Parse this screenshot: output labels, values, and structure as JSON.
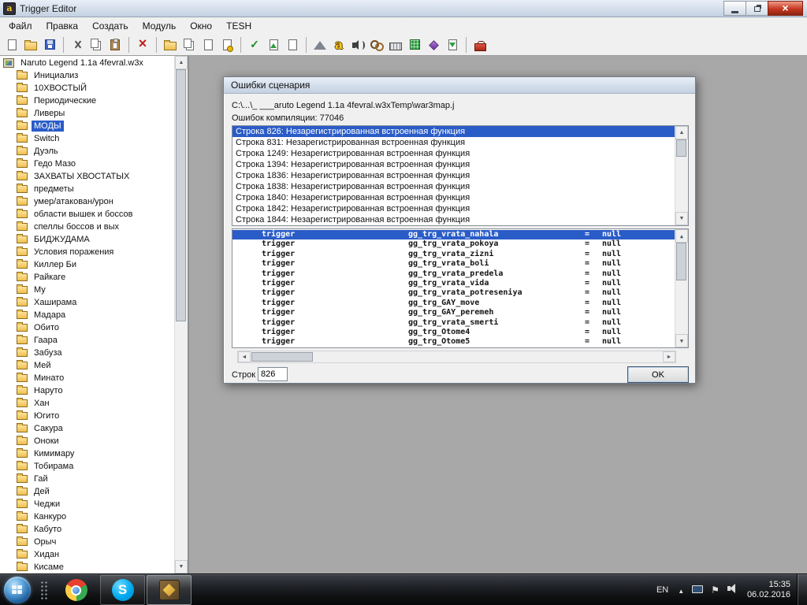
{
  "colors": {
    "selection": "#2a5cc8",
    "close": "#c4371f",
    "titlebar_top": "#e9eff8",
    "titlebar_bottom": "#c3d1e1"
  },
  "window": {
    "title": "Trigger Editor"
  },
  "menubar": {
    "items": [
      {
        "id": "file",
        "label": "Файл"
      },
      {
        "id": "edit",
        "label": "Правка"
      },
      {
        "id": "create",
        "label": "Создать"
      },
      {
        "id": "module",
        "label": "Модуль"
      },
      {
        "id": "window",
        "label": "Окно"
      },
      {
        "id": "tesh",
        "label": "TESH"
      }
    ]
  },
  "toolbar": {
    "items": [
      {
        "name": "new-map-icon",
        "kind": "page"
      },
      {
        "name": "open-map-icon",
        "kind": "folderopen"
      },
      {
        "name": "save-map-icon",
        "kind": "floppy"
      },
      {
        "sep": true
      },
      {
        "name": "cut-icon",
        "kind": "scissors"
      },
      {
        "name": "copy-icon",
        "kind": "copy"
      },
      {
        "name": "paste-icon",
        "kind": "paste"
      },
      {
        "sep": true
      },
      {
        "name": "delete-icon",
        "kind": "xred"
      },
      {
        "sep": true
      },
      {
        "name": "new-category-icon",
        "kind": "folderopen"
      },
      {
        "name": "new-trigger-icon",
        "kind": "copy"
      },
      {
        "name": "new-comment-icon",
        "kind": "page"
      },
      {
        "name": "new-script-icon",
        "kind": "pagestar"
      },
      {
        "sep": true
      },
      {
        "name": "enable-trigger-icon",
        "kind": "check"
      },
      {
        "name": "convert-script-icon",
        "kind": "pageup"
      },
      {
        "name": "run-on-init-icon",
        "kind": "page"
      },
      {
        "sep": true
      },
      {
        "name": "terrain-editor-icon",
        "kind": "terrain"
      },
      {
        "name": "trigger-editor-icon",
        "kind": "lettera"
      },
      {
        "name": "sound-editor-icon",
        "kind": "sound"
      },
      {
        "name": "object-editor-icon",
        "kind": "rings"
      },
      {
        "name": "campaign-editor-icon",
        "kind": "keyboard"
      },
      {
        "name": "ai-editor-icon",
        "kind": "gridgreen"
      },
      {
        "name": "object-manager-icon",
        "kind": "diamond"
      },
      {
        "name": "import-manager-icon",
        "kind": "pageimp"
      },
      {
        "sep": true
      },
      {
        "name": "test-map-icon",
        "kind": "toolbox"
      }
    ]
  },
  "tree": {
    "root": "Naruto Legend 1.1a 4fevral.w3x",
    "items": [
      {
        "label": "Инициализ"
      },
      {
        "label": "10ХВОСТЫЙ"
      },
      {
        "label": "Периодические"
      },
      {
        "label": "Ливеры"
      },
      {
        "label": "МОДЫ",
        "selected": true
      },
      {
        "label": "Switch"
      },
      {
        "label": "Дуэль"
      },
      {
        "label": "Гедо Мазо"
      },
      {
        "label": "ЗАХВАТЫ ХВОСТАТЫХ"
      },
      {
        "label": "предметы"
      },
      {
        "label": "умер/атакован/урон"
      },
      {
        "label": "области вышек и боссов"
      },
      {
        "label": "спеллы боссов и вых"
      },
      {
        "label": "БИДЖУДАМА"
      },
      {
        "label": "Условия поражения"
      },
      {
        "label": "Киллер Би"
      },
      {
        "label": "Райкаге"
      },
      {
        "label": "Му"
      },
      {
        "label": "Хаширама"
      },
      {
        "label": "Мадара"
      },
      {
        "label": "Обито"
      },
      {
        "label": "Гаара"
      },
      {
        "label": "Забуза"
      },
      {
        "label": "Мей"
      },
      {
        "label": "Минато"
      },
      {
        "label": "Наруто"
      },
      {
        "label": "Хан"
      },
      {
        "label": "Югито"
      },
      {
        "label": "Сакура"
      },
      {
        "label": "Оноки"
      },
      {
        "label": "Кимимару"
      },
      {
        "label": "Тобирама"
      },
      {
        "label": "Гай"
      },
      {
        "label": "Дей"
      },
      {
        "label": "Чеджи"
      },
      {
        "label": "Канкуро"
      },
      {
        "label": "Кабуто"
      },
      {
        "label": "Орыч"
      },
      {
        "label": "Хидан"
      },
      {
        "label": "Кисаме"
      }
    ]
  },
  "dialog": {
    "title": "Ошибки сценария",
    "file_path": "C:\\...\\_ ___aruto Legend 1.1a 4fevral.w3xTemp\\war3map.j",
    "error_count_label": "Ошибок компиляции: 77046",
    "selected_error_index": 0,
    "errors": [
      "Строка 826: Незарегистрированная встроенная функция",
      "Строка 831: Незарегистрированная встроенная функция",
      "Строка 1249: Незарегистрированная встроенная функция",
      "Строка 1394: Незарегистрированная встроенная функция",
      "Строка 1836: Незарегистрированная встроенная функция",
      "Строка 1838: Незарегистрированная встроенная функция",
      "Строка 1840: Незарегистрированная встроенная функция",
      "Строка 1842: Незарегистрированная встроенная функция",
      "Строка 1844: Незарегистрированная встроенная функция"
    ],
    "code": {
      "selected_index": 0,
      "lines": [
        {
          "kw": "trigger",
          "name": "gg_trg_vrata_nahala",
          "eq": "=",
          "val": "null"
        },
        {
          "kw": "trigger",
          "name": "gg_trg_vrata_pokoya",
          "eq": "=",
          "val": "null"
        },
        {
          "kw": "trigger",
          "name": "gg_trg_vrata_zizni",
          "eq": "=",
          "val": "null"
        },
        {
          "kw": "trigger",
          "name": "gg_trg_vrata_boli",
          "eq": "=",
          "val": "null"
        },
        {
          "kw": "trigger",
          "name": "gg_trg_vrata_predela",
          "eq": "=",
          "val": "null"
        },
        {
          "kw": "trigger",
          "name": "gg_trg_vrata_vida",
          "eq": "=",
          "val": "null"
        },
        {
          "kw": "trigger",
          "name": "gg_trg_vrata_potreseniya",
          "eq": "=",
          "val": "null"
        },
        {
          "kw": "trigger",
          "name": "gg_trg_GAY_move",
          "eq": "=",
          "val": "null"
        },
        {
          "kw": "trigger",
          "name": "gg_trg_GAY_peremeh",
          "eq": "=",
          "val": "null"
        },
        {
          "kw": "trigger",
          "name": "gg_trg_vrata_smerti",
          "eq": "=",
          "val": "null"
        },
        {
          "kw": "trigger",
          "name": "gg_trg_Otome4",
          "eq": "=",
          "val": "null"
        },
        {
          "kw": "trigger",
          "name": "gg_trg_Otome5",
          "eq": "=",
          "val": "null"
        }
      ]
    },
    "line_label": "Строк",
    "line_value": "826",
    "ok_label": "OK"
  },
  "taskbar": {
    "apps": [
      {
        "name": "chrome",
        "icon": "chrome-icon"
      },
      {
        "name": "skype",
        "icon": "skype-icon",
        "running": true
      },
      {
        "name": "world-editor",
        "icon": "we-icon",
        "active": true
      }
    ],
    "tray": {
      "language": "EN",
      "icons": [
        {
          "name": "hidden-icons-button",
          "kind": "caret"
        },
        {
          "name": "network-icon",
          "kind": "monitor"
        },
        {
          "name": "action-center-icon",
          "kind": "flag"
        },
        {
          "name": "volume-icon",
          "kind": "speaker"
        }
      ],
      "time": "15:35",
      "date": "06.02.2016"
    }
  }
}
